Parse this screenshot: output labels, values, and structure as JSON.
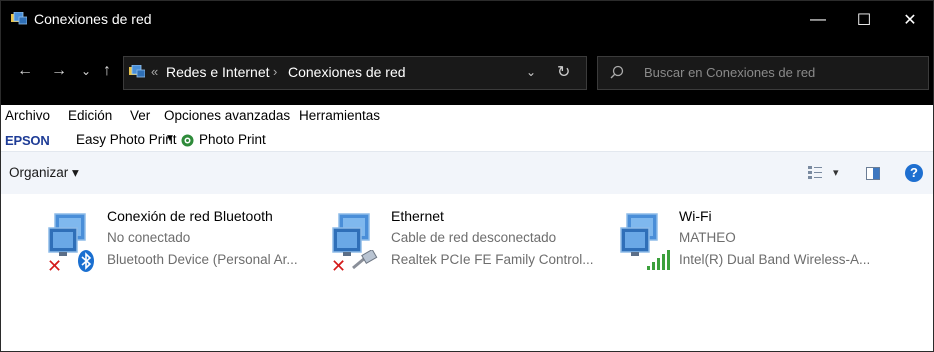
{
  "window": {
    "title": "Conexiones de red",
    "minimize": "—",
    "maximize": "☐",
    "close": "✕"
  },
  "nav": {
    "back": "←",
    "forward": "→",
    "recent": "⌄",
    "up": "↑",
    "breadcrumb_sep_start": "«",
    "breadcrumb": [
      "Redes e Internet",
      "Conexiones de red"
    ],
    "breadcrumb_sep": "›",
    "dropdown": "⌄",
    "refresh": "↻",
    "search_placeholder": "Buscar en Conexiones de red"
  },
  "menu": [
    "Archivo",
    "Edición",
    "Ver",
    "Opciones avanzadas",
    "Herramientas"
  ],
  "epson": {
    "logo": "EPSON",
    "easy_photo_print": "Easy Photo Print",
    "photo_print": "Photo Print",
    "caret": "▼"
  },
  "commandbar": {
    "organize": "Organizar ▾",
    "view_caret": "▾",
    "help": "?"
  },
  "connections": [
    {
      "name": "Conexión de red Bluetooth",
      "status": "No conectado",
      "device": "Bluetooth Device (Personal Ar...",
      "type": "bluetooth",
      "state": "disconnected"
    },
    {
      "name": "Ethernet",
      "status": "Cable de red desconectado",
      "device": "Realtek PCIe FE Family Control...",
      "type": "ethernet",
      "state": "disconnected"
    },
    {
      "name": "Wi-Fi",
      "status": "MATHEO",
      "device": "Intel(R) Dual Band Wireless-A...",
      "type": "wifi",
      "state": "connected"
    }
  ],
  "colors": {
    "titlebar_bg": "#000000",
    "address_bg": "#191919",
    "commandbar_bg": "#f2f5fa",
    "help_blue": "#1e6fd0",
    "error_red": "#d41a1a",
    "wifi_green": "#3ca03c"
  }
}
